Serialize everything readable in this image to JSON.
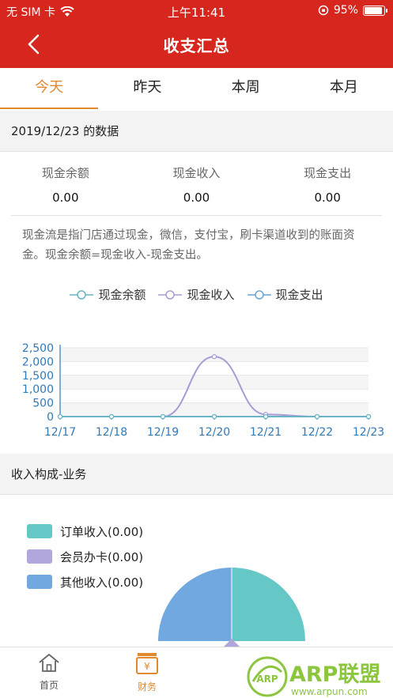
{
  "status_bar": {
    "carrier": "无 SIM 卡",
    "time": "上午11:41",
    "battery": "95%",
    "battery_level": 0.95
  },
  "header": {
    "title": "收支汇总"
  },
  "tabs": [
    {
      "label": "今天"
    },
    {
      "label": "昨天"
    },
    {
      "label": "本周"
    },
    {
      "label": "本月"
    }
  ],
  "data_section": {
    "title": "2019/12/23 的数据"
  },
  "stats": [
    {
      "label": "现金余额",
      "value": "0.00"
    },
    {
      "label": "现金收入",
      "value": "0.00"
    },
    {
      "label": "现金支出",
      "value": "0.00"
    }
  ],
  "description": "现金流是指门店通过现金，微信，支付宝，刷卡渠道收到的账面资金。现金余额=现金收入-现金支出。",
  "chart_data": {
    "type": "line",
    "x": [
      "12/17",
      "12/18",
      "12/19",
      "12/20",
      "12/21",
      "12/22",
      "12/23"
    ],
    "yticks": [
      "2,500",
      "2,000",
      "1,500",
      "1,000",
      "500",
      "0"
    ],
    "ylim": [
      0,
      2500
    ],
    "grid": true,
    "legend_position": "top-center",
    "series": [
      {
        "name": "现金余额",
        "color": "#69b5c6",
        "values": [
          0,
          0,
          0,
          0,
          0,
          0,
          0
        ]
      },
      {
        "name": "现金收入",
        "color": "#a99bd6",
        "values": [
          0,
          0,
          0,
          2180,
          80,
          0,
          0
        ]
      },
      {
        "name": "现金支出",
        "color": "#6aa4d1",
        "values": [
          0,
          0,
          0,
          0,
          0,
          0,
          0
        ]
      }
    ]
  },
  "income_section": {
    "title": "收入构成-业务"
  },
  "pie_legend": [
    {
      "label": "订单收入(0.00)",
      "color": "#66c7c7"
    },
    {
      "label": "会员办卡(0.00)",
      "color": "#b3a6dc"
    },
    {
      "label": "其他收入(0.00)",
      "color": "#72a8e0"
    }
  ],
  "tabbar": [
    {
      "label": "首页",
      "icon": "home-icon"
    },
    {
      "label": "财务",
      "icon": "finance-icon"
    }
  ],
  "watermark": {
    "text": "ARP联盟",
    "url": "www.arpun.com"
  }
}
